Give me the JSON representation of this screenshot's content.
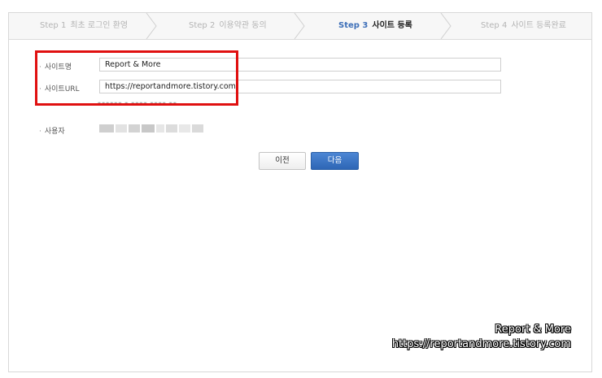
{
  "steps": [
    {
      "num": "Step 1",
      "label": "최초 로그인 환영"
    },
    {
      "num": "Step 2",
      "label": "이용약관 동의"
    },
    {
      "num": "Step 3",
      "label": "사이트 등록"
    },
    {
      "num": "Step 4",
      "label": "사이트 등록완료"
    }
  ],
  "active_step": 3,
  "form": {
    "site_name_label": "사이트명",
    "site_name_value": "Report & More",
    "site_url_label": "사이트URL",
    "site_url_value": "https://reportandmore.tistory.com/",
    "user_label": "사용자"
  },
  "buttons": {
    "prev": "이전",
    "next": "다음"
  },
  "colors": {
    "highlight": "#e01010",
    "primary": "#2e66b5",
    "active_step_num": "#3d6fb8"
  },
  "watermark": {
    "title": "Report & More",
    "url": "https://reportandmore.tistory.com"
  }
}
